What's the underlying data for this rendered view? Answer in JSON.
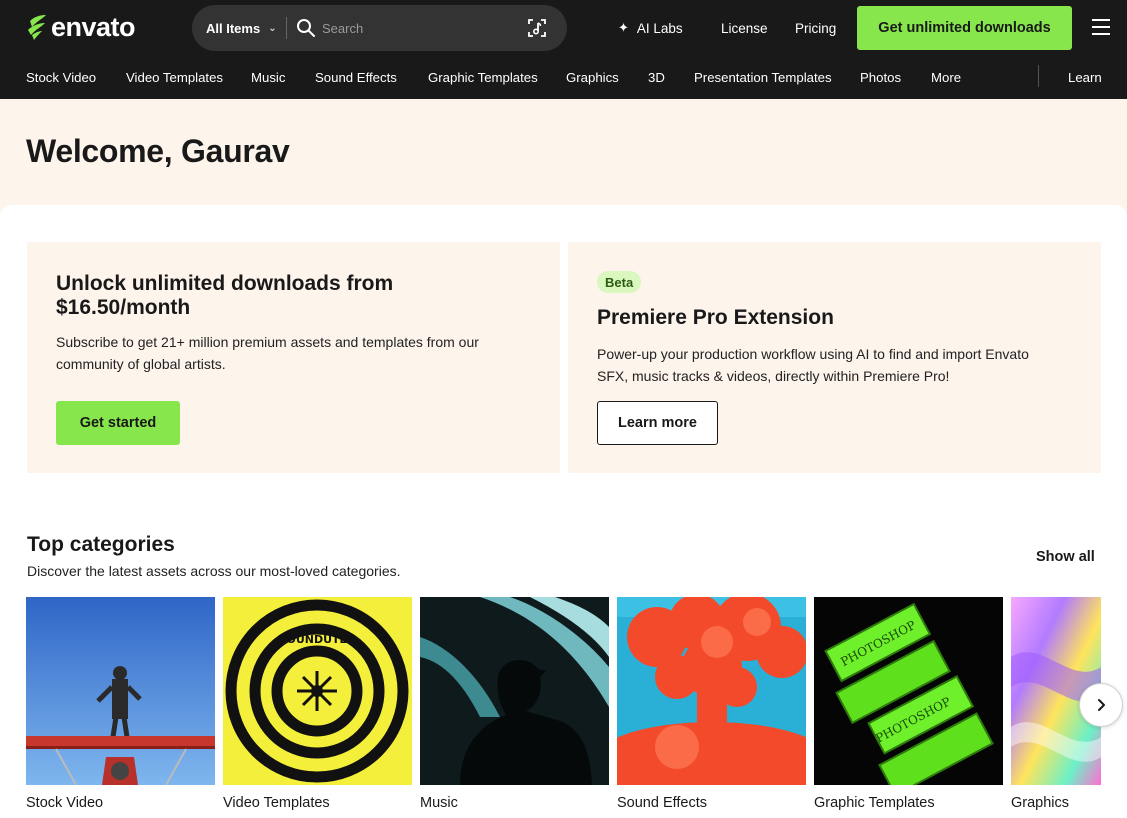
{
  "header": {
    "logo_text": "envato",
    "search_scope": "All Items",
    "search_placeholder": "Search",
    "ai_labs": "AI Labs",
    "license": "License",
    "pricing": "Pricing",
    "cta": "Get unlimited downloads"
  },
  "categories_nav": [
    "Stock Video",
    "Video Templates",
    "Music",
    "Sound Effects",
    "Graphic Templates",
    "Graphics",
    "3D",
    "Presentation Templates",
    "Photos",
    "More",
    "Learn"
  ],
  "welcome": "Welcome, Gaurav",
  "promo_left": {
    "title_line1": "Unlock unlimited downloads from",
    "title_line2": "$16.50/month",
    "desc_line1": "Subscribe to get 21+ million premium assets and templates from our",
    "desc_line2": "community of global artists.",
    "button": "Get started"
  },
  "promo_right": {
    "badge": "Beta",
    "title": "Premiere Pro Extension",
    "desc_line1": "Power-up your production workflow using AI to find and import Envato",
    "desc_line2": "SFX, music tracks & videos, directly within Premiere Pro!",
    "button": "Learn more"
  },
  "top_categories": {
    "title": "Top categories",
    "subtitle": "Discover the latest assets across our most-loved categories.",
    "show_all": "Show all",
    "items": [
      {
        "label": "Stock Video"
      },
      {
        "label": "Video Templates"
      },
      {
        "label": "Music"
      },
      {
        "label": "Sound Effects"
      },
      {
        "label": "Graphic Templates"
      },
      {
        "label": "Graphics"
      }
    ],
    "mockup_text": "PHOTOSHOP",
    "pattern_text": "YOUNDUTLU"
  },
  "colors": {
    "header_bg": "#191919",
    "accent_green": "#87e64b",
    "cream": "#fdf4ec"
  }
}
